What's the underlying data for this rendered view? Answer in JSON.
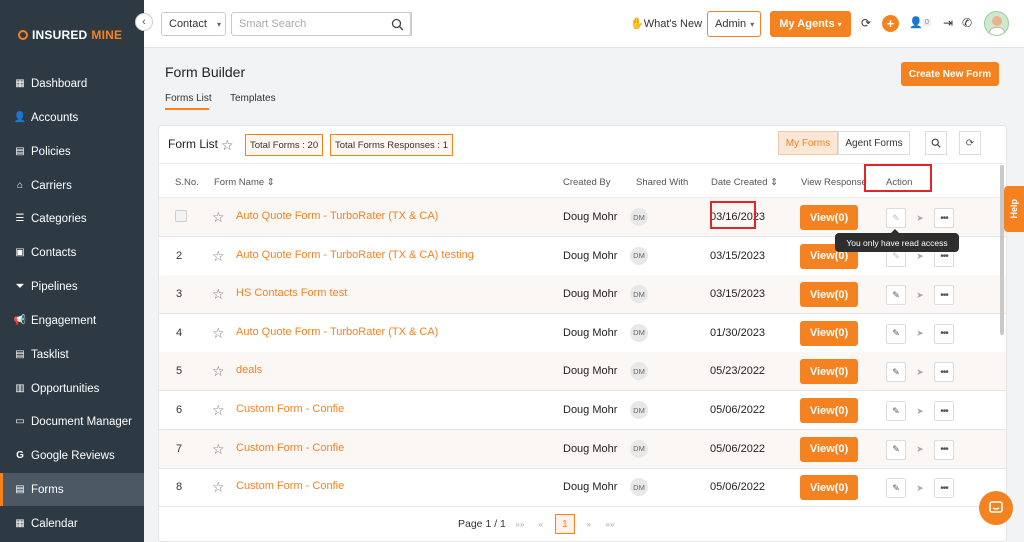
{
  "brand": {
    "part1": "INSURED",
    "part2": "MINE"
  },
  "sidebar": {
    "items": [
      {
        "label": "Dashboard",
        "icon": "dashboard-icon"
      },
      {
        "label": "Accounts",
        "icon": "user-icon"
      },
      {
        "label": "Policies",
        "icon": "document-icon"
      },
      {
        "label": "Carriers",
        "icon": "bank-icon"
      },
      {
        "label": "Categories",
        "icon": "list-icon"
      },
      {
        "label": "Contacts",
        "icon": "contact-card-icon"
      },
      {
        "label": "Pipelines",
        "icon": "filter-icon"
      },
      {
        "label": "Engagement",
        "icon": "megaphone-icon"
      },
      {
        "label": "Tasklist",
        "icon": "tasklist-icon"
      },
      {
        "label": "Opportunities",
        "icon": "bar-chart-icon"
      },
      {
        "label": "Document Manager",
        "icon": "folder-icon"
      },
      {
        "label": "Google Reviews",
        "icon": "google-icon"
      },
      {
        "label": "Forms",
        "icon": "form-icon"
      },
      {
        "label": "Calendar",
        "icon": "calendar-icon"
      }
    ]
  },
  "topbar": {
    "contact_select": "Contact",
    "search_placeholder": "Smart Search",
    "whats_new": "What's New",
    "admin": "Admin",
    "my_agents": "My Agents",
    "notification_count": "0"
  },
  "page": {
    "title": "Form Builder",
    "tabs": [
      "Forms List",
      "Templates"
    ],
    "create_button": "Create New Form"
  },
  "card": {
    "title": "Form List",
    "total_forms": "Total Forms : 20",
    "total_responses": "Total Forms Responses : 1",
    "my_forms": "My Forms",
    "agent_forms": "Agent Forms"
  },
  "table": {
    "headers": {
      "sno": "S.No.",
      "name": "Form Name",
      "created_by": "Created By",
      "shared_with": "Shared With",
      "date_created": "Date Created",
      "view_response": "View Response",
      "action": "Action"
    },
    "rows": [
      {
        "sno": "",
        "name": "Auto Quote Form - TurboRater (TX & CA)",
        "created_by": "Doug Mohr",
        "shared": "DM",
        "date": "03/16/2023",
        "view": "View(0)"
      },
      {
        "sno": "2",
        "name": "Auto Quote Form - TurboRater (TX & CA) testing",
        "created_by": "Doug Mohr",
        "shared": "DM",
        "date": "03/15/2023",
        "view": "View(0)"
      },
      {
        "sno": "3",
        "name": "HS Contacts Form test",
        "created_by": "Doug Mohr",
        "shared": "DM",
        "date": "03/15/2023",
        "view": "View(0)"
      },
      {
        "sno": "4",
        "name": "Auto Quote Form - TurboRater (TX & CA)",
        "created_by": "Doug Mohr",
        "shared": "DM",
        "date": "01/30/2023",
        "view": "View(0)"
      },
      {
        "sno": "5",
        "name": "deals",
        "created_by": "Doug Mohr",
        "shared": "DM",
        "date": "05/23/2022",
        "view": "View(0)"
      },
      {
        "sno": "6",
        "name": "Custom Form - Confie",
        "created_by": "Doug Mohr",
        "shared": "DM",
        "date": "05/06/2022",
        "view": "View(0)"
      },
      {
        "sno": "7",
        "name": "Custom Form - Confie",
        "created_by": "Doug Mohr",
        "shared": "DM",
        "date": "05/06/2022",
        "view": "View(0)"
      },
      {
        "sno": "8",
        "name": "Custom Form - Confie",
        "created_by": "Doug Mohr",
        "shared": "DM",
        "date": "05/06/2022",
        "view": "View(0)"
      }
    ],
    "tooltip": "You only have read access"
  },
  "pagination": {
    "label": "Page 1 / 1",
    "current": "1"
  },
  "help_tab": "Help",
  "colors": {
    "accent": "#f58220",
    "sidebar": "#2d3a44",
    "highlight": "#e0252b"
  }
}
